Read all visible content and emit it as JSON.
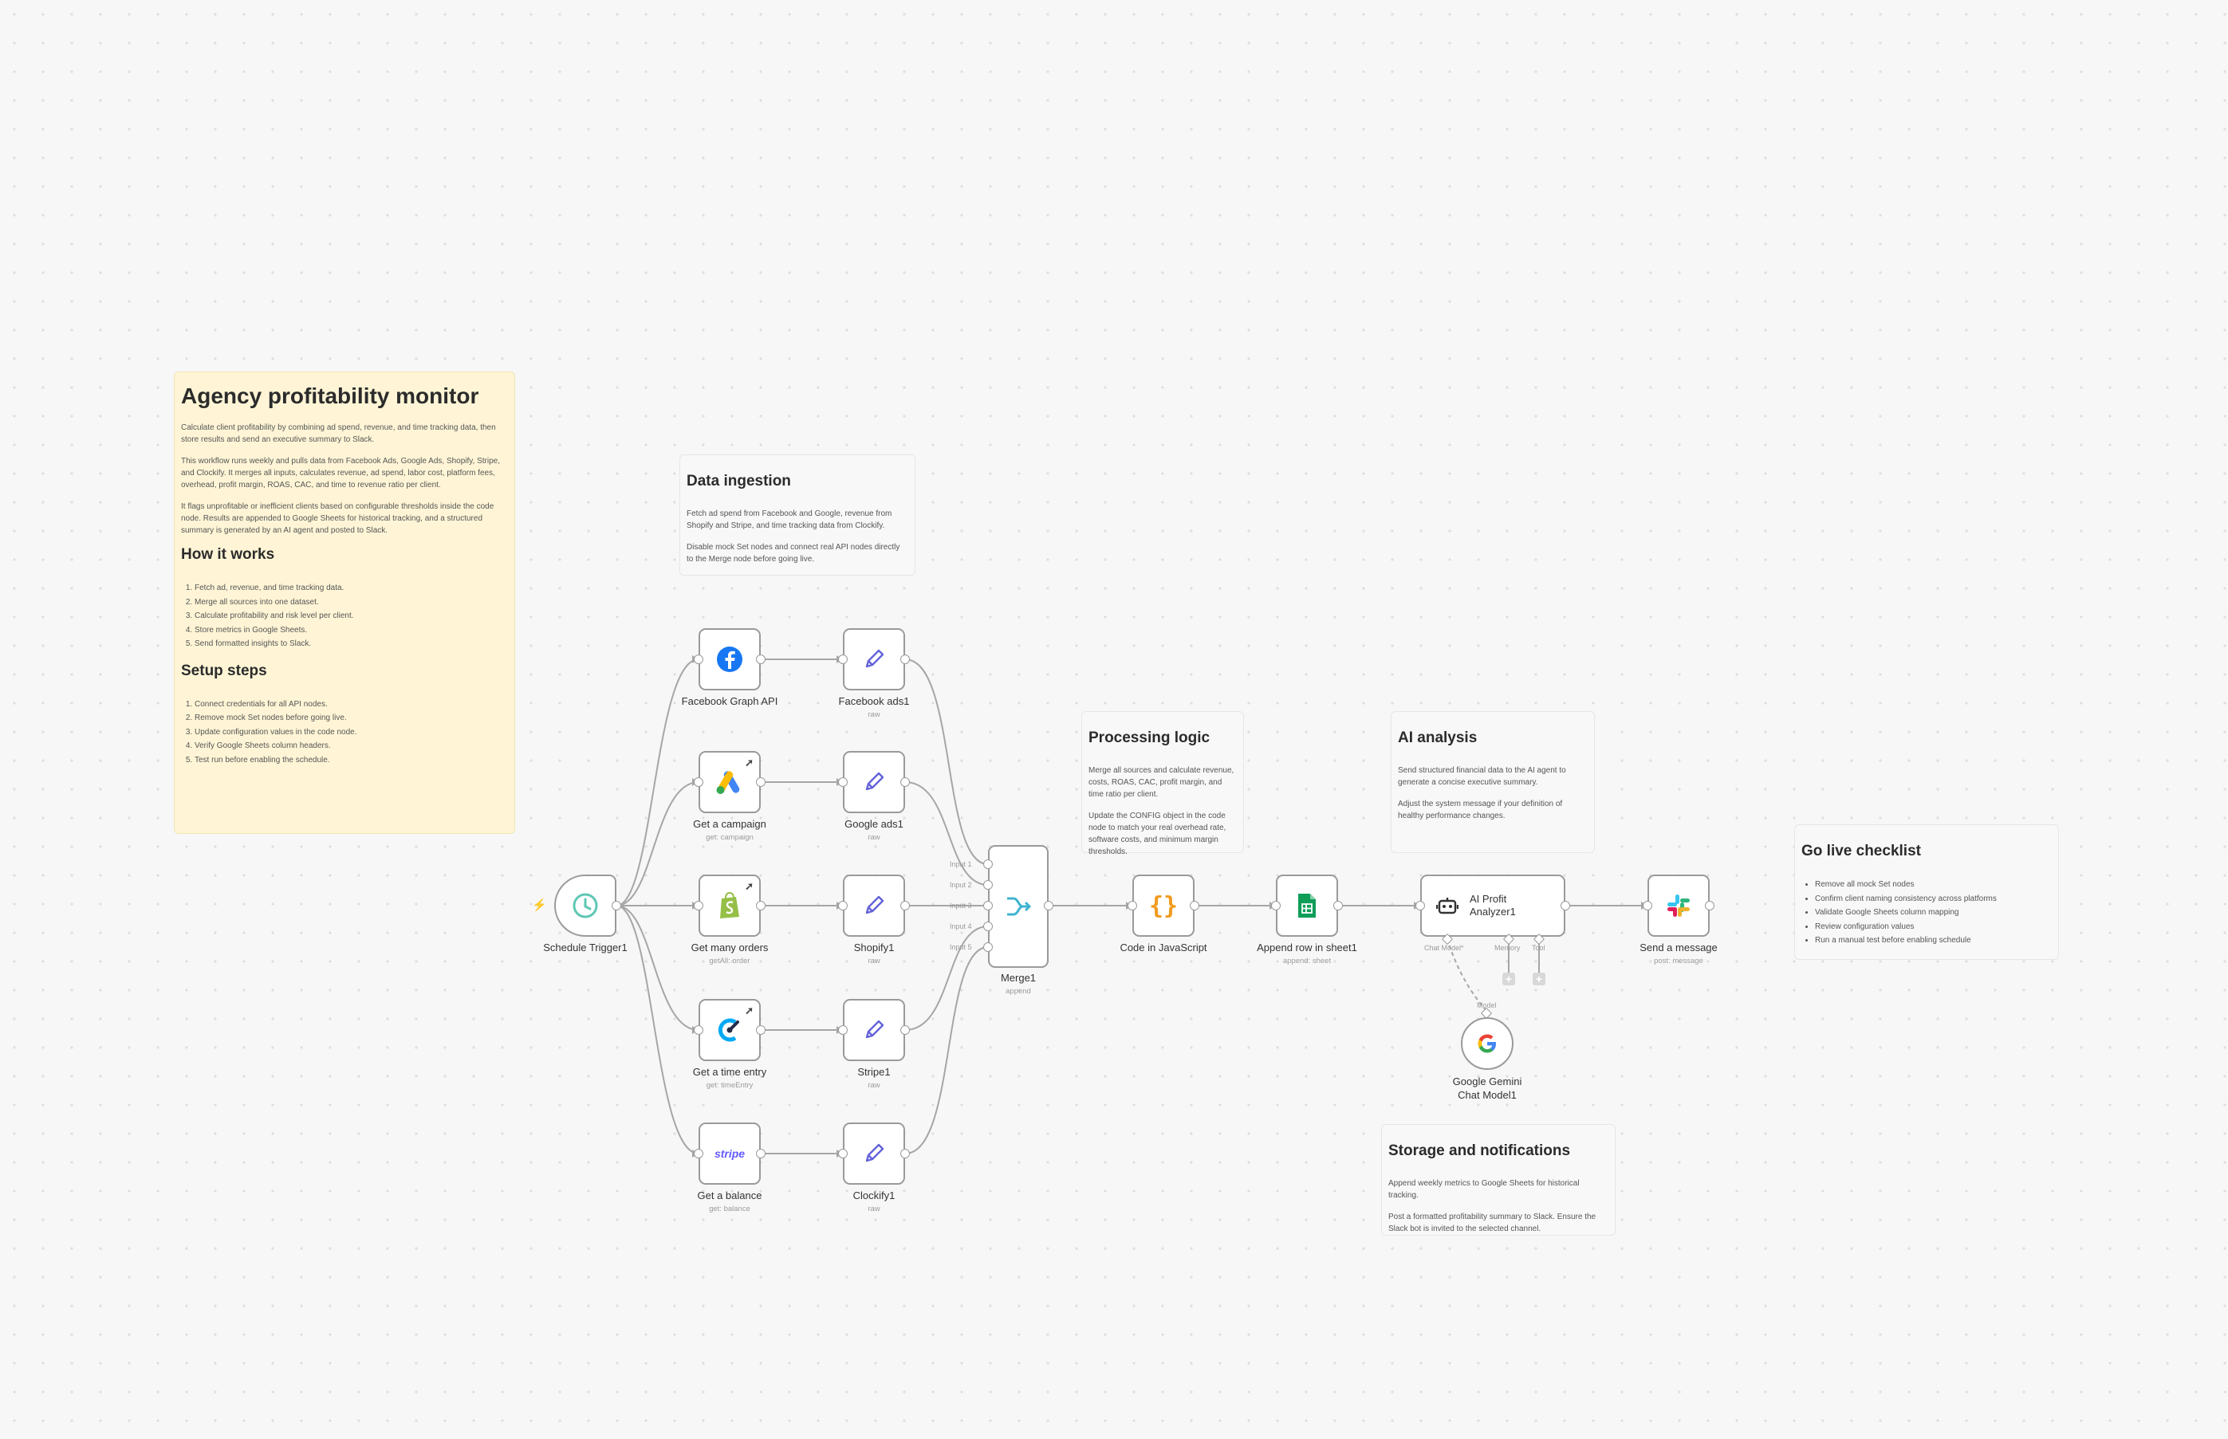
{
  "colors": {
    "canvas": "#f7f7f7",
    "sticky_yellow": "#fff5d6",
    "node_border": "#9a9a9a",
    "edge": "#9a9a9a",
    "trigger_accent": "#5ec7b4",
    "facebook": "#1877f2",
    "shopify": "#95bf47",
    "stripe": "#635bff",
    "clockify": "#03a9f4",
    "code_orange": "#f29b1f",
    "sheets_green": "#0f9d58",
    "bolt": "#ff6d5a"
  },
  "notes": {
    "main": {
      "title": "Agency profitability monitor",
      "p1": "Calculate client profitability by combining ad spend, revenue, and time tracking data, then store results and send an executive summary to Slack.",
      "p2": "This workflow runs weekly and pulls data from Facebook Ads, Google Ads, Shopify, Stripe, and Clockify. It merges all inputs, calculates revenue, ad spend, labor cost, platform fees, overhead, profit margin, ROAS, CAC, and time to revenue ratio per client.",
      "p3": "It flags unprofitable or inefficient clients based on configurable thresholds inside the code node. Results are appended to Google Sheets for historical tracking, and a structured summary is generated by an AI agent and posted to Slack.",
      "how_title": "How it works",
      "how_steps": [
        "Fetch ad, revenue, and time tracking data.",
        "Merge all sources into one dataset.",
        "Calculate profitability and risk level per client.",
        "Store metrics in Google Sheets.",
        "Send formatted insights to Slack."
      ],
      "setup_title": "Setup steps",
      "setup_steps": [
        "Connect credentials for all API nodes.",
        "Remove mock Set nodes before going live.",
        "Update configuration values in the code node.",
        "Verify Google Sheets column headers.",
        "Test run before enabling the schedule."
      ]
    },
    "ingestion": {
      "title": "Data ingestion",
      "p1": "Fetch ad spend from Facebook and Google, revenue from Shopify and Stripe, and time tracking data from Clockify.",
      "p2": "Disable mock Set nodes and connect real API nodes directly to the Merge node before going live."
    },
    "processing": {
      "title": "Processing logic",
      "p1": "Merge all sources and calculate revenue, costs, ROAS, CAC, profit margin, and time ratio per client.",
      "p2": "Update the CONFIG object in the code node to match your real overhead rate, software costs, and minimum margin thresholds."
    },
    "ai": {
      "title": "AI analysis",
      "p1": "Send structured financial data to the AI agent to generate a concise executive summary.",
      "p2": "Adjust the system message if your definition of healthy performance changes."
    },
    "golive": {
      "title": "Go live checklist",
      "items": [
        "Remove all mock Set nodes",
        "Confirm client naming consistency across platforms",
        "Validate Google Sheets column mapping",
        "Review configuration values",
        "Run a manual test before enabling schedule"
      ]
    },
    "storage": {
      "title": "Storage and notifications",
      "p1": "Append weekly metrics to Google Sheets for historical tracking.",
      "p2": "Post a formatted profitability summary to Slack. Ensure the Slack bot is invited to the selected channel."
    }
  },
  "nodes": {
    "schedule": {
      "label": "Schedule Trigger1",
      "icon": "clock-icon"
    },
    "fb_graph": {
      "label": "Facebook Graph API",
      "icon": "facebook-icon"
    },
    "get_campaign": {
      "label": "Get a campaign",
      "sub": "get: campaign",
      "icon": "google-ads-icon"
    },
    "get_orders": {
      "label": "Get many orders",
      "sub": "getAll: order",
      "icon": "shopify-icon"
    },
    "get_time": {
      "label": "Get a time entry",
      "sub": "get: timeEntry",
      "icon": "clockify-icon"
    },
    "get_balance": {
      "label": "Get a balance",
      "sub": "get: balance",
      "icon": "stripe-icon",
      "icon_text": "stripe"
    },
    "fb_ads": {
      "label": "Facebook ads1",
      "sub": "raw",
      "icon": "pencil-icon"
    },
    "google_ads": {
      "label": "Google ads1",
      "sub": "raw",
      "icon": "pencil-icon"
    },
    "shopify": {
      "label": "Shopify1",
      "sub": "raw",
      "icon": "pencil-icon"
    },
    "stripe": {
      "label": "Stripe1",
      "sub": "raw",
      "icon": "pencil-icon"
    },
    "clockify": {
      "label": "Clockify1",
      "sub": "raw",
      "icon": "pencil-icon"
    },
    "merge": {
      "label": "Merge1",
      "sub": "append",
      "inputs": [
        "Input 1",
        "Input 2",
        "Input 3",
        "Input 4",
        "Input 5"
      ]
    },
    "code": {
      "label": "Code in JavaScript",
      "icon": "code-braces-icon",
      "icon_text": "{}"
    },
    "sheets": {
      "label": "Append row in sheet1",
      "sub": "append: sheet",
      "icon": "google-sheets-icon"
    },
    "agent": {
      "label": "AI Profit Analyzer1",
      "icon": "robot-icon",
      "ports": {
        "chat_model": "Chat Model*",
        "memory": "Memory",
        "tool": "Tool"
      }
    },
    "slack": {
      "label": "Send a message",
      "sub": "post: message",
      "icon": "slack-icon"
    },
    "gemini": {
      "label": "Google Gemini Chat Model1",
      "port_label": "Model",
      "icon": "google-icon"
    }
  }
}
